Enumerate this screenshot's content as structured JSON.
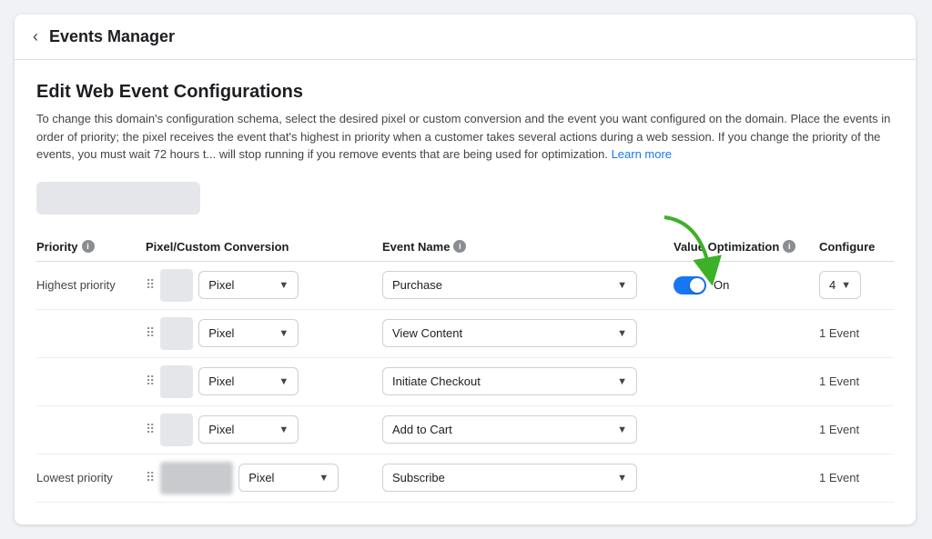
{
  "header": {
    "title": "Events Manager",
    "back_label": "‹"
  },
  "main": {
    "section_title": "Edit Web Event Configurations",
    "description": "To change this domain's configuration schema, select the desired pixel or custom conversion and the event you want configured on the domain. Place the events in order of priority; the pixel receives the event that's highest in priority when a customer takes several actions during a web session. If you change the priority of the events, you must wait 72 hours t... will stop running if you remove events that are being used for optimization.",
    "learn_more": "Learn more",
    "columns": {
      "priority": "Priority",
      "pixel": "Pixel/Custom Conversion",
      "event_name": "Event Name",
      "value_optimization": "Value Optimization",
      "configured": "Configure"
    },
    "rows": [
      {
        "priority_label": "Highest priority",
        "pixel_value": "Pixel",
        "event_value": "Purchase",
        "has_toggle": true,
        "toggle_on": true,
        "toggle_label": "On",
        "config_value": "4",
        "event_count": "",
        "blurred_pixel": false
      },
      {
        "priority_label": "",
        "pixel_value": "Pixel",
        "event_value": "View Content",
        "has_toggle": false,
        "toggle_on": false,
        "toggle_label": "",
        "config_value": "",
        "event_count": "1 Event",
        "blurred_pixel": false
      },
      {
        "priority_label": "",
        "pixel_value": "Pixel",
        "event_value": "Initiate Checkout",
        "has_toggle": false,
        "toggle_on": false,
        "toggle_label": "",
        "config_value": "",
        "event_count": "1 Event",
        "blurred_pixel": false
      },
      {
        "priority_label": "",
        "pixel_value": "Pixel",
        "event_value": "Add to Cart",
        "has_toggle": false,
        "toggle_on": false,
        "toggle_label": "",
        "config_value": "",
        "event_count": "1 Event",
        "blurred_pixel": false
      },
      {
        "priority_label": "Lowest priority",
        "pixel_value": "Pixel",
        "event_value": "Subscribe",
        "has_toggle": false,
        "toggle_on": false,
        "toggle_label": "",
        "config_value": "",
        "event_count": "1 Event",
        "blurred_pixel": true
      }
    ]
  },
  "icons": {
    "info": "i",
    "chevron_down": "▼",
    "drag": "⠿",
    "back": "‹"
  },
  "colors": {
    "toggle_blue": "#1877f2",
    "link_blue": "#1877f2",
    "arrow_green": "#3cb128"
  }
}
